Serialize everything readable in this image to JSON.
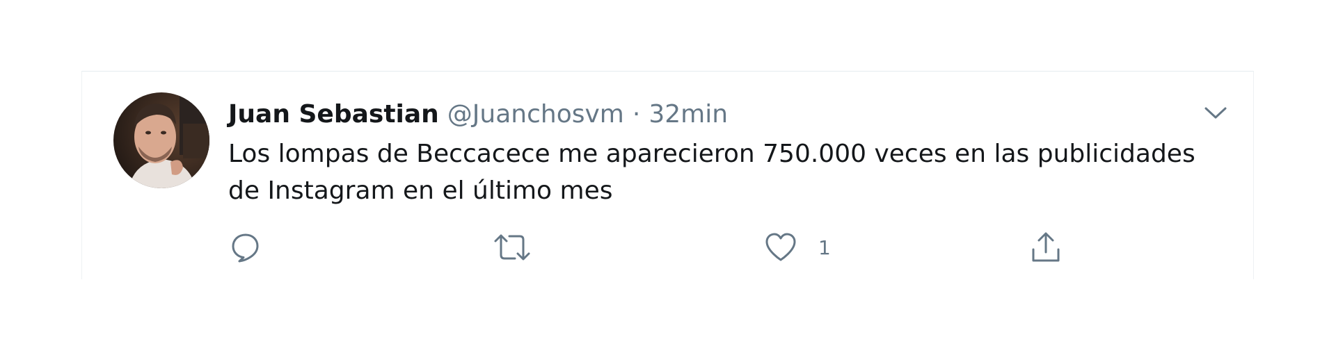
{
  "tweet": {
    "author": {
      "display_name": "Juan Sebastian",
      "handle": "@Juanchosvm"
    },
    "separator": "·",
    "timestamp": "32min",
    "text_lines": [
      "Los lompas de Beccacece me aparecieron 750.000 veces en las publicidades",
      "de Instagram en el último mes"
    ],
    "actions": {
      "reply": {
        "icon": "reply-bubble-icon"
      },
      "retweet": {
        "icon": "retweet-icon"
      },
      "like": {
        "icon": "heart-icon",
        "count": "1"
      },
      "share": {
        "icon": "share-upload-icon"
      }
    },
    "menu_icon": "chevron-down-icon"
  },
  "colors": {
    "text_primary": "#14171a",
    "text_secondary": "#657786",
    "icon": "#657786",
    "border": "#e6ecf0"
  }
}
